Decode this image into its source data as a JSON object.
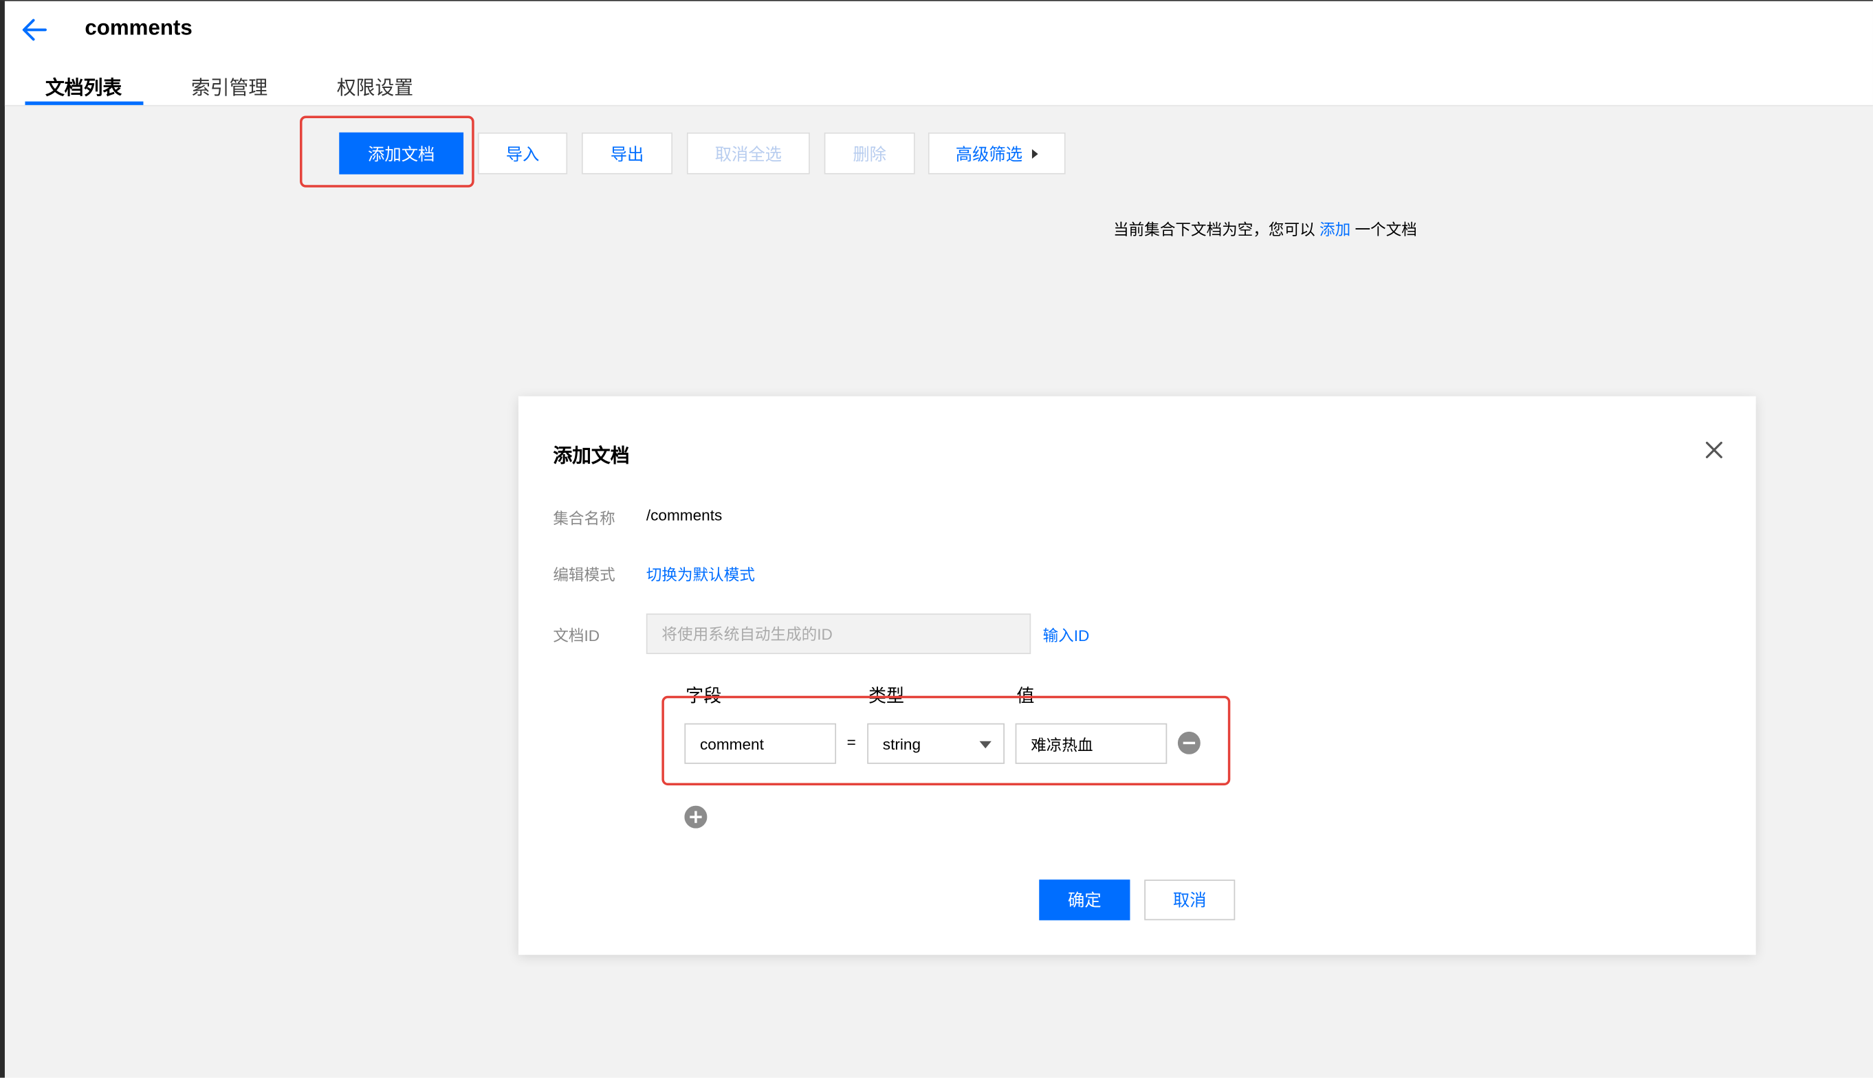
{
  "header": {
    "title": "comments",
    "tabs": [
      {
        "label": "文档列表",
        "active": true
      },
      {
        "label": "索引管理",
        "active": false
      },
      {
        "label": "权限设置",
        "active": false
      }
    ]
  },
  "toolbar": {
    "add_label": "添加文档",
    "import_label": "导入",
    "export_label": "导出",
    "deselect_label": "取消全选",
    "delete_label": "删除",
    "filter_label": "高级筛选"
  },
  "empty_state": {
    "prefix": "当前集合下文档为空，您可以",
    "link": "添加",
    "suffix": "一个文档"
  },
  "dialog": {
    "title": "添加文档",
    "collection_label": "集合名称",
    "collection_value": "/comments",
    "mode_label": "编辑模式",
    "mode_link": "切换为默认模式",
    "id_label": "文档ID",
    "id_placeholder": "将使用系统自动生成的ID",
    "id_link": "输入ID",
    "columns": {
      "field": "字段",
      "type": "类型",
      "value": "值"
    },
    "row": {
      "field": "comment",
      "equals": "=",
      "type": "string",
      "value": "难凉热血"
    },
    "confirm_label": "确定",
    "cancel_label": "取消"
  },
  "colors": {
    "accent": "#006eff",
    "highlight": "#e5423a"
  }
}
